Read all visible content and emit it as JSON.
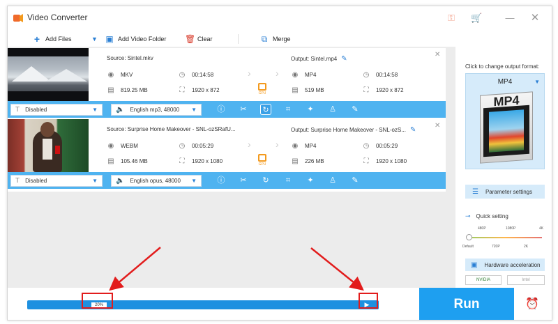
{
  "app": {
    "title": "Video Converter"
  },
  "toolbar": {
    "add_files": "Add Files",
    "add_folder": "Add Video Folder",
    "clear": "Clear",
    "merge": "Merge"
  },
  "items": [
    {
      "source": "Source: Sintel.mkv",
      "output": "Output: Sintel.mp4",
      "src_format": "MKV",
      "src_duration": "00:14:58",
      "src_size": "819.25 MB",
      "src_resolution": "1920 x 872",
      "out_format": "MP4",
      "out_duration": "00:14:58",
      "out_size": "519 MB",
      "out_resolution": "1920 x 872",
      "gpu_label": "GPU",
      "subtitle": "Disabled",
      "audio": "English mp3, 48000"
    },
    {
      "source": "Source: Surprise Home Makeover - SNL-ozSRafU...",
      "output": "Output: Surprise Home Makeover - SNL-ozS...",
      "src_format": "WEBM",
      "src_duration": "00:05:29",
      "src_size": "105.46 MB",
      "src_resolution": "1920 x 1080",
      "out_format": "MP4",
      "out_duration": "00:05:29",
      "out_size": "226 MB",
      "out_resolution": "1920 x 1080",
      "gpu_label": "GPU",
      "subtitle": "Disabled",
      "audio": "English opus, 48000"
    }
  ],
  "right_panel": {
    "change_label": "Click to change output format:",
    "format": "MP4",
    "format_icon_text": "MP4",
    "parameter_settings": "Parameter settings",
    "quick_setting": "Quick setting",
    "quality_top": [
      "480P",
      "1080P",
      "4K"
    ],
    "quality_bottom": [
      "Default",
      "720P",
      "2K"
    ],
    "hardware_acceleration": "Hardware acceleration",
    "vendors": [
      "NVIDIA",
      "Intel"
    ]
  },
  "bottom": {
    "progress_label": "20%",
    "progress_value": 0.2,
    "run_label": "Run"
  },
  "colors": {
    "accent": "#1e9ff0",
    "bar": "#4fb3f0",
    "annotation": "#e21c1c",
    "gpu": "#f39a1e"
  }
}
